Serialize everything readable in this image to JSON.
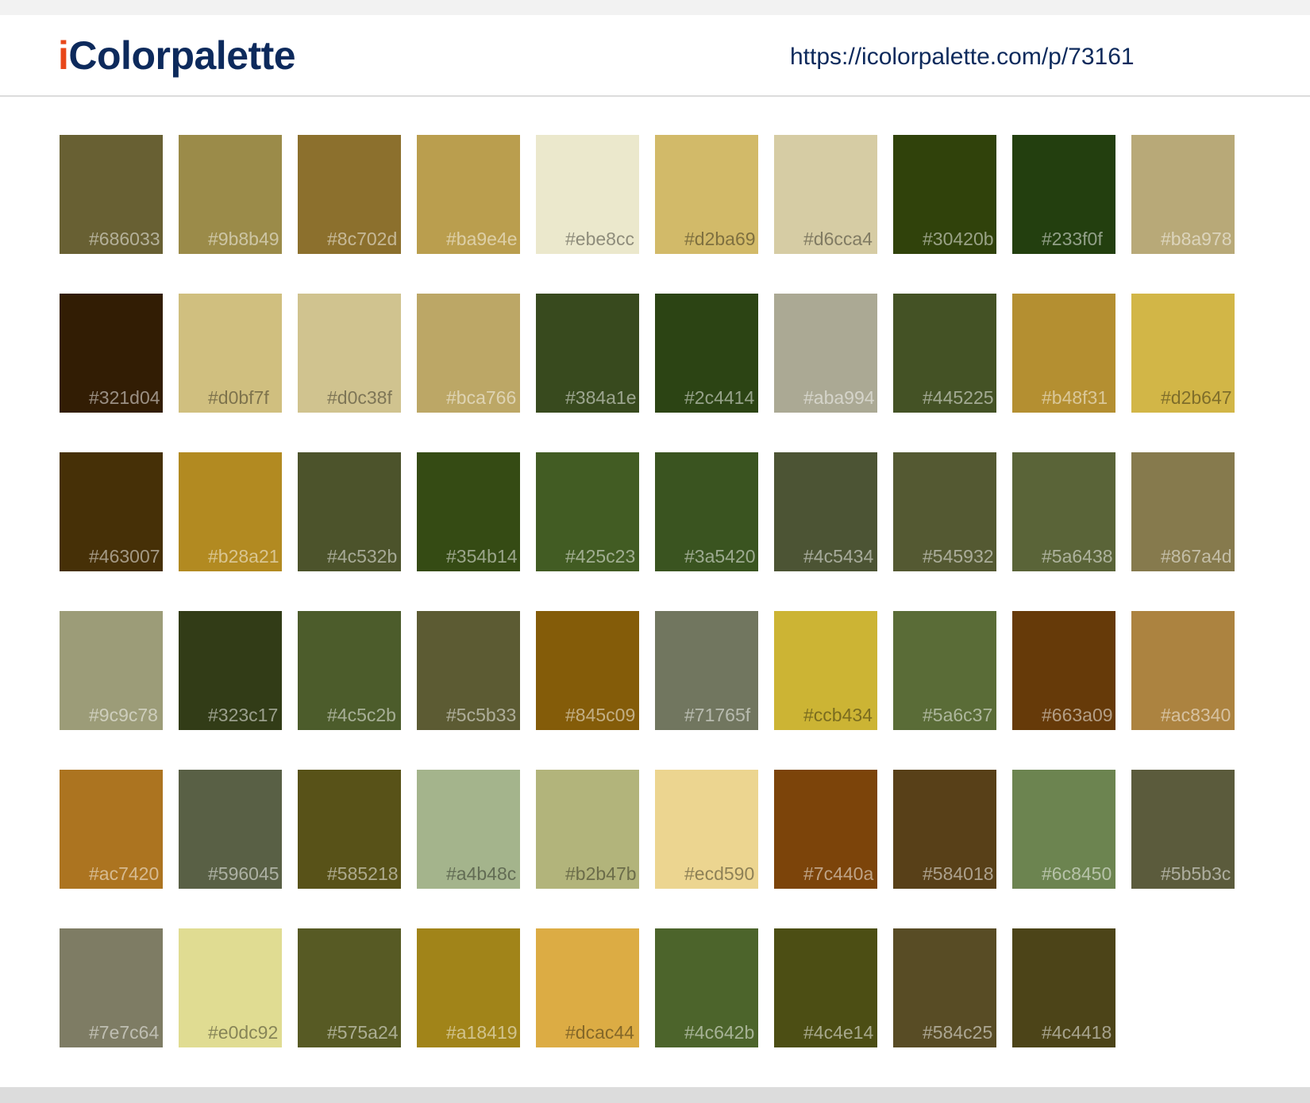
{
  "header": {
    "logo_accent": "i",
    "logo_rest": "Colorpalette",
    "url": "https://icolorpalette.com/p/73161"
  },
  "swatches": [
    "#686033",
    "#9b8b49",
    "#8c702d",
    "#ba9e4e",
    "#ebe8cc",
    "#d2ba69",
    "#d6cca4",
    "#30420b",
    "#233f0f",
    "#b8a978",
    "#321d04",
    "#d0bf7f",
    "#d0c38f",
    "#bca766",
    "#384a1e",
    "#2c4414",
    "#aba994",
    "#445225",
    "#b48f31",
    "#d2b647",
    "#463007",
    "#b28a21",
    "#4c532b",
    "#354b14",
    "#425c23",
    "#3a5420",
    "#4c5434",
    "#545932",
    "#5a6438",
    "#867a4d",
    "#9c9c78",
    "#323c17",
    "#4c5c2b",
    "#5c5b33",
    "#845c09",
    "#71765f",
    "#ccb434",
    "#5a6c37",
    "#663a09",
    "#ac8340",
    "#ac7420",
    "#596045",
    "#585218",
    "#a4b48c",
    "#b2b47b",
    "#ecd590",
    "#7c440a",
    "#584018",
    "#6c8450",
    "#5b5b3c",
    "#7e7c64",
    "#e0dc92",
    "#575a24",
    "#a18419",
    "#dcac44",
    "#4c642b",
    "#4c4e14",
    "#584c25",
    "#4c4418"
  ]
}
